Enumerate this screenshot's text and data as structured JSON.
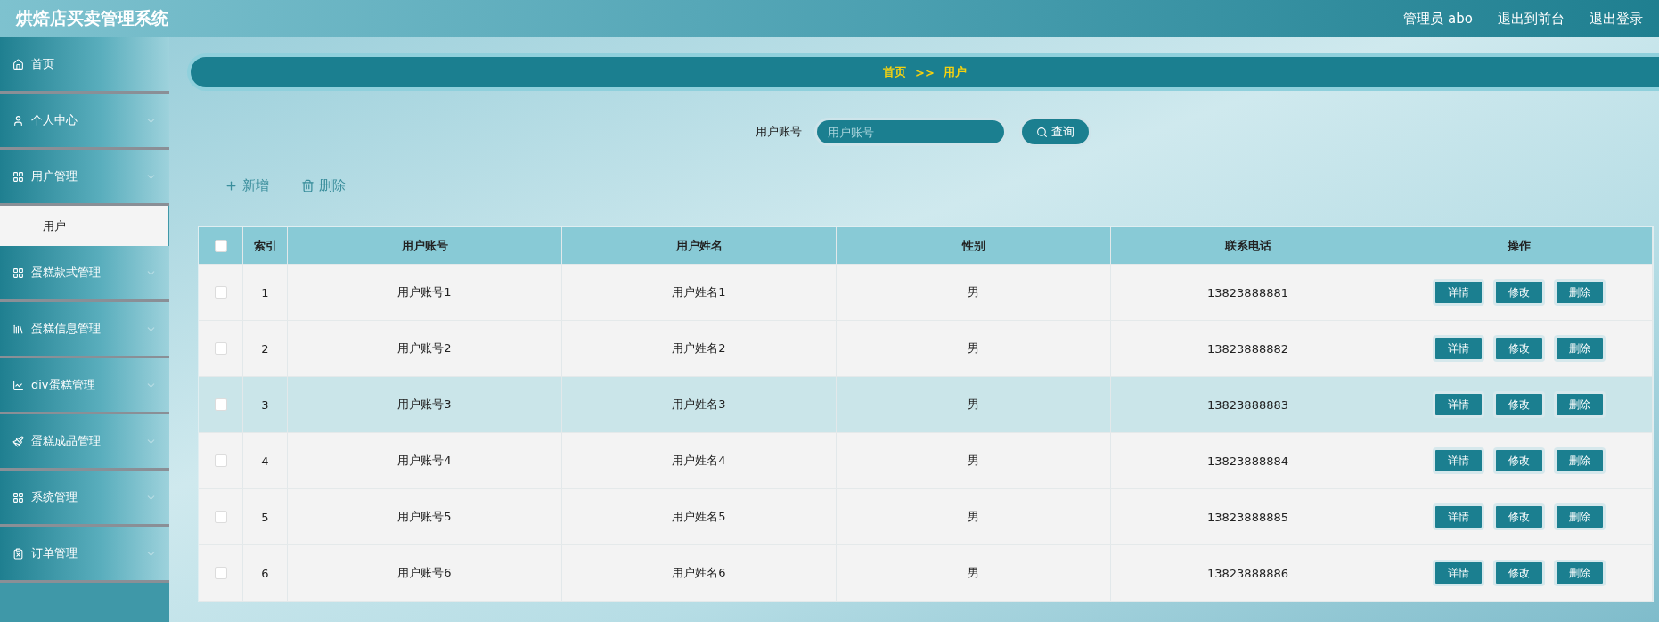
{
  "app_title": "烘焙店买卖管理系统",
  "header_links": [
    {
      "label": "管理员 abo"
    },
    {
      "label": "退出到前台"
    },
    {
      "label": "退出登录"
    }
  ],
  "sidebar": {
    "items": [
      {
        "label": "首页",
        "expandable": false
      },
      {
        "label": "个人中心",
        "expandable": true
      },
      {
        "label": "用户管理",
        "expandable": true,
        "children": [
          {
            "label": "用户",
            "selected": true
          }
        ]
      },
      {
        "label": "蛋糕款式管理",
        "expandable": true
      },
      {
        "label": "蛋糕信息管理",
        "expandable": true
      },
      {
        "label": "div蛋糕管理",
        "expandable": true
      },
      {
        "label": "蛋糕成品管理",
        "expandable": true
      },
      {
        "label": "系统管理",
        "expandable": true
      },
      {
        "label": "订单管理",
        "expandable": true
      }
    ]
  },
  "breadcrumb": [
    "首页",
    ">>",
    "用户"
  ],
  "search": {
    "label": "用户账号",
    "placeholder": "用户账号",
    "button": "查询"
  },
  "actions": [
    {
      "kind": "add",
      "label": "新增"
    },
    {
      "kind": "delete",
      "label": "删除"
    }
  ],
  "table": {
    "columns": [
      "索引",
      "用户账号",
      "用户姓名",
      "性别",
      "联系电话",
      "操作"
    ],
    "header_checked": false,
    "rows": [
      {
        "cells": [
          "1",
          "用户账号1",
          "用户姓名1",
          "男",
          "13823888881"
        ],
        "buttons": [
          "详情",
          "修改",
          "删除"
        ],
        "checked": false,
        "selected": false
      },
      {
        "cells": [
          "2",
          "用户账号2",
          "用户姓名2",
          "男",
          "13823888882"
        ],
        "buttons": [
          "详情",
          "修改",
          "删除"
        ],
        "checked": false,
        "selected": false
      },
      {
        "cells": [
          "3",
          "用户账号3",
          "用户姓名3",
          "男",
          "13823888883"
        ],
        "buttons": [
          "详情",
          "修改",
          "删除"
        ],
        "checked": false,
        "selected": true
      },
      {
        "cells": [
          "4",
          "用户账号4",
          "用户姓名4",
          "男",
          "13823888884"
        ],
        "buttons": [
          "详情",
          "修改",
          "删除"
        ],
        "checked": false,
        "selected": false
      },
      {
        "cells": [
          "5",
          "用户账号5",
          "用户姓名5",
          "男",
          "13823888885"
        ],
        "buttons": [
          "详情",
          "修改",
          "删除"
        ],
        "checked": false,
        "selected": false
      },
      {
        "cells": [
          "6",
          "用户账号6",
          "用户姓名6",
          "男",
          "13823888886"
        ],
        "buttons": [
          "详情",
          "修改",
          "删除"
        ],
        "checked": false,
        "selected": false
      }
    ]
  }
}
